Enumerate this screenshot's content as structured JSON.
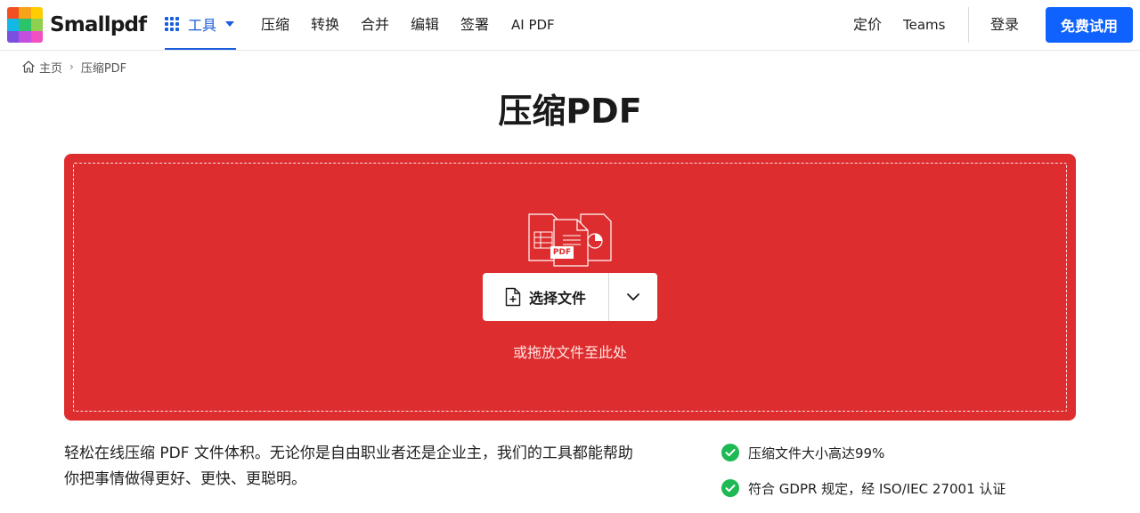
{
  "nav": {
    "brand": "Smallpdf",
    "tools_label": "工具",
    "links": [
      "压缩",
      "转换",
      "合并",
      "编辑",
      "签署",
      "AI PDF"
    ],
    "pricing": "定价",
    "teams": "Teams",
    "login": "登录",
    "trial": "免费试用"
  },
  "breadcrumb": {
    "home": "主页",
    "current": "压缩PDF"
  },
  "page": {
    "title": "压缩PDF"
  },
  "dropzone": {
    "choose_label": "选择文件",
    "hint": "或拖放文件至此处",
    "badge": "PDF"
  },
  "description": "轻松在线压缩 PDF 文件体积。无论你是自由职业者还是企业主，我们的工具都能帮助你把事情做得更好、更快、更聪明。",
  "features": [
    "压缩文件大小高达99%",
    "符合 GDPR 规定，经 ISO/IEC 27001 认证"
  ],
  "colors": {
    "accent": "#0f62fe",
    "dropzone": "#de2d2e",
    "check": "#1db954"
  },
  "icons": {
    "home": "home-icon",
    "tools": "grid-icon",
    "dropdown": "chevron-down-icon",
    "check": "check-circle-icon"
  }
}
